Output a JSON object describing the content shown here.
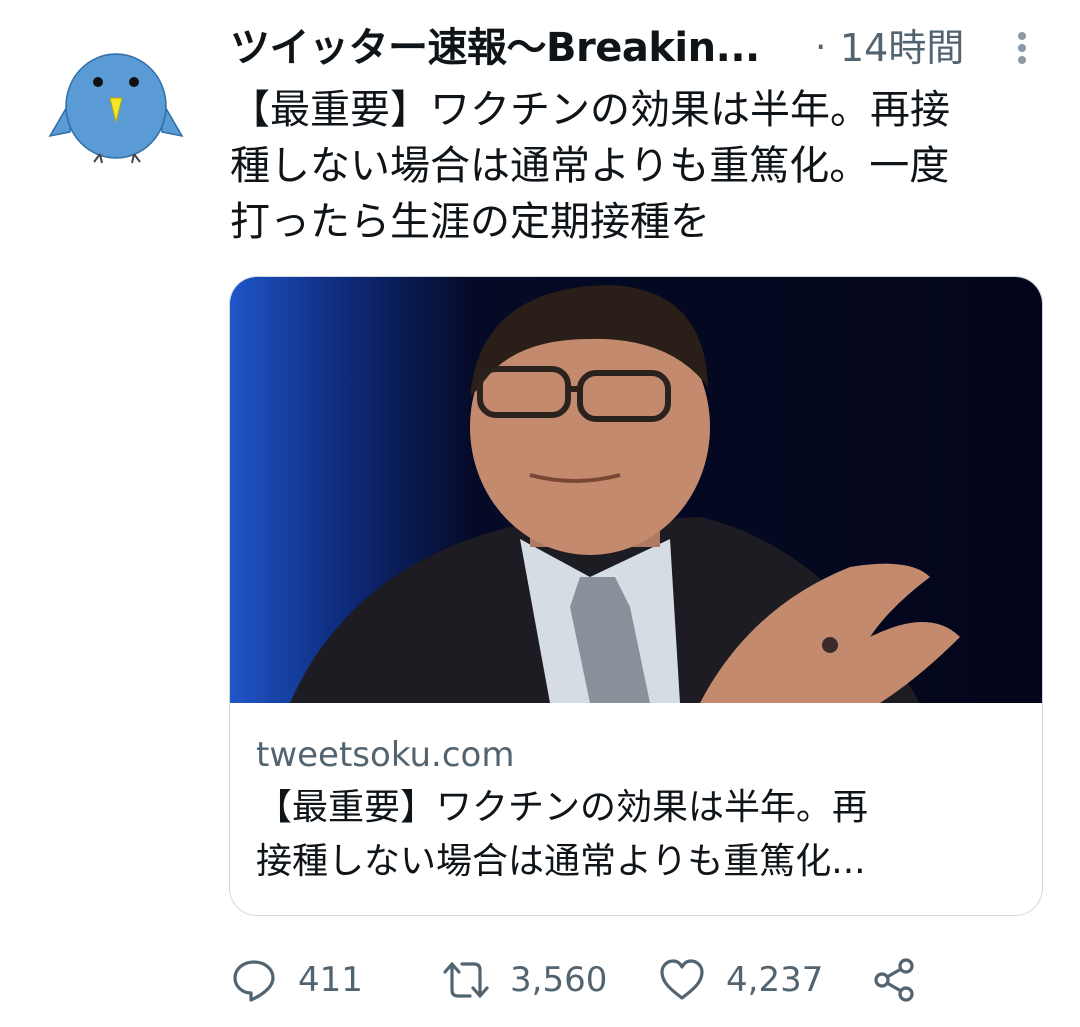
{
  "tweet": {
    "author": "ツイッター速報〜Breakin...",
    "separator": "·",
    "time": "14時間",
    "text": "【最重要】ワクチンの効果は半年。再接\n種しない場合は通常よりも重篤化。一度\n打ったら生涯の定期接種を",
    "avatar_icon": "bird-avatar-icon"
  },
  "card": {
    "domain": "tweetsoku.com",
    "title": "【最重要】ワクチンの効果は半年。再\n接種しない場合は通常よりも重篤化..."
  },
  "actions": {
    "reply_count": "411",
    "retweet_count": "3,560",
    "like_count": "4,237"
  },
  "colors": {
    "text_primary": "#0f1419",
    "text_secondary": "#536471",
    "border": "#cfd9de",
    "avatar_blue": "#5b9bd5",
    "avatar_beak": "#f5e726"
  }
}
